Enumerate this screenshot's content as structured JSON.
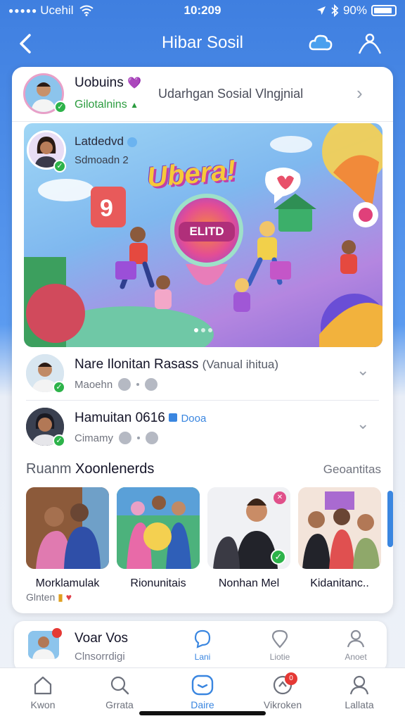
{
  "status_bar": {
    "carrier": "Ucehil",
    "time": "10:209",
    "battery_text": "90%",
    "battery_level": 0.9
  },
  "header": {
    "title": "Hibar Sosil"
  },
  "profile": {
    "name": "Uobuins",
    "subtitle": "Gilotalnins",
    "description": "Udarhgan Sosial Vlngjnial"
  },
  "banner": {
    "user_name": "Latdedvd",
    "user_sub": "Sdmoadn 2",
    "logo_text": "Ubera!",
    "badge_text": "ELITD"
  },
  "posts": [
    {
      "name": "Nare Ilonitan Rasass",
      "name_extra": "(Vanual ihitua)",
      "meta": "Maoehn"
    },
    {
      "name": "Hamuitan 0616",
      "tag": "Dooa",
      "meta": "Cimamy"
    }
  ],
  "section": {
    "title_prefix": "Ruanm",
    "title": "Xoonlenerds",
    "link": "Geoantitas"
  },
  "tiles": [
    {
      "label": "Morklamulak",
      "sub": "Glnten"
    },
    {
      "label": "Rionunitais",
      "sub": ""
    },
    {
      "label": "Nonhan Mel",
      "sub": ""
    },
    {
      "label": "Kidanitanc..",
      "sub": ""
    }
  ],
  "mini_card": {
    "name": "Voar Vos",
    "sub": "Clnsorrdigi",
    "tabs": [
      "Lani",
      "Liotie",
      "Anoet"
    ]
  },
  "tabbar": {
    "items": [
      "Kwon",
      "Grrata",
      "Daire",
      "Vikroken",
      "Lallata"
    ],
    "notification_count": "0"
  },
  "colors": {
    "accent": "#3a86e0",
    "verified": "#2db34a",
    "header_bg": "#3f7fe0"
  }
}
